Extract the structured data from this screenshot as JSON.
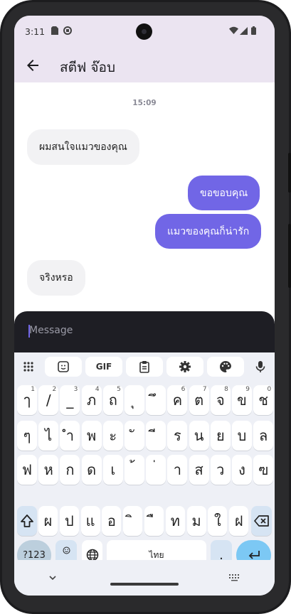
{
  "status": {
    "time": "3:11"
  },
  "appbar": {
    "title": "สตีฟ จ๊อบ"
  },
  "chat": {
    "timestamp": "15:09",
    "messages": [
      {
        "text": "ผมสนใจแมวของคุณ",
        "direction": "incoming"
      },
      {
        "text": "ขอขอบคุณ",
        "direction": "outgoing"
      },
      {
        "text": "แมวของคุณก็น่ารัก",
        "direction": "outgoing"
      },
      {
        "text": "จริงหรอ",
        "direction": "incoming"
      }
    ]
  },
  "compose": {
    "placeholder": "Message"
  },
  "keyboard": {
    "toolbar": [
      "apps-icon",
      "sticker-icon",
      "GIF",
      "clipboard-icon",
      "settings-icon",
      "palette-icon",
      "mic-icon"
    ],
    "gif_label": "GIF",
    "row1": [
      {
        "k": "ๅ",
        "s": "1"
      },
      {
        "k": "/",
        "s": "2"
      },
      {
        "k": "_",
        "s": "3"
      },
      {
        "k": "ภ",
        "s": "4"
      },
      {
        "k": "ถ",
        "s": "5"
      },
      {
        "k": "ุ",
        "s": ""
      },
      {
        "k": "ึ",
        "s": ""
      },
      {
        "k": "ค",
        "s": "6"
      },
      {
        "k": "ต",
        "s": "7"
      },
      {
        "k": "จ",
        "s": "8"
      },
      {
        "k": "ข",
        "s": "9"
      },
      {
        "k": "ช",
        "s": "0"
      }
    ],
    "row2": [
      "ๆ",
      "ไ",
      "ำ",
      "พ",
      "ะ",
      "ั",
      "ี",
      "ร",
      "น",
      "ย",
      "บ",
      "ล"
    ],
    "row3": [
      "ฟ",
      "ห",
      "ก",
      "ด",
      "เ",
      "้",
      "่",
      "า",
      "ส",
      "ว",
      "ง",
      "ฃ"
    ],
    "row4": [
      "ผ",
      "ป",
      "แ",
      "อ",
      "ิ",
      "ื",
      "ท",
      "ม",
      "ใ",
      "ฝ"
    ],
    "bottom": {
      "symbols": "?123",
      "emoji_comma": ",",
      "space": "ไทย",
      "period": "."
    },
    "colors": {
      "accent": "#7166e6",
      "enter": "#7cc8f4"
    }
  }
}
